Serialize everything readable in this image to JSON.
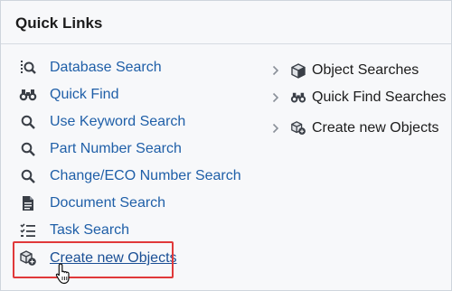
{
  "panel": {
    "title": "Quick Links"
  },
  "left_links": [
    {
      "label": "Database Search",
      "icon": "database-search-icon"
    },
    {
      "label": "Quick Find",
      "icon": "binoculars-icon"
    },
    {
      "label": "Use Keyword Search",
      "icon": "magnifier-icon"
    },
    {
      "label": "Part Number Search",
      "icon": "magnifier-icon"
    },
    {
      "label": "Change/ECO Number Search",
      "icon": "magnifier-icon"
    },
    {
      "label": "Document Search",
      "icon": "document-icon"
    },
    {
      "label": "Task Search",
      "icon": "task-list-icon"
    },
    {
      "label": "Create new Objects",
      "icon": "create-object-icon"
    }
  ],
  "right_links": [
    {
      "label": "Object Searches",
      "icon": "cube-icon"
    },
    {
      "label": "Quick Find Searches",
      "icon": "binoculars-icon"
    },
    {
      "label": "Create new Objects",
      "icon": "create-object-icon"
    }
  ],
  "colors": {
    "link": "#1f5fa8",
    "highlight_border": "#e0393a"
  }
}
